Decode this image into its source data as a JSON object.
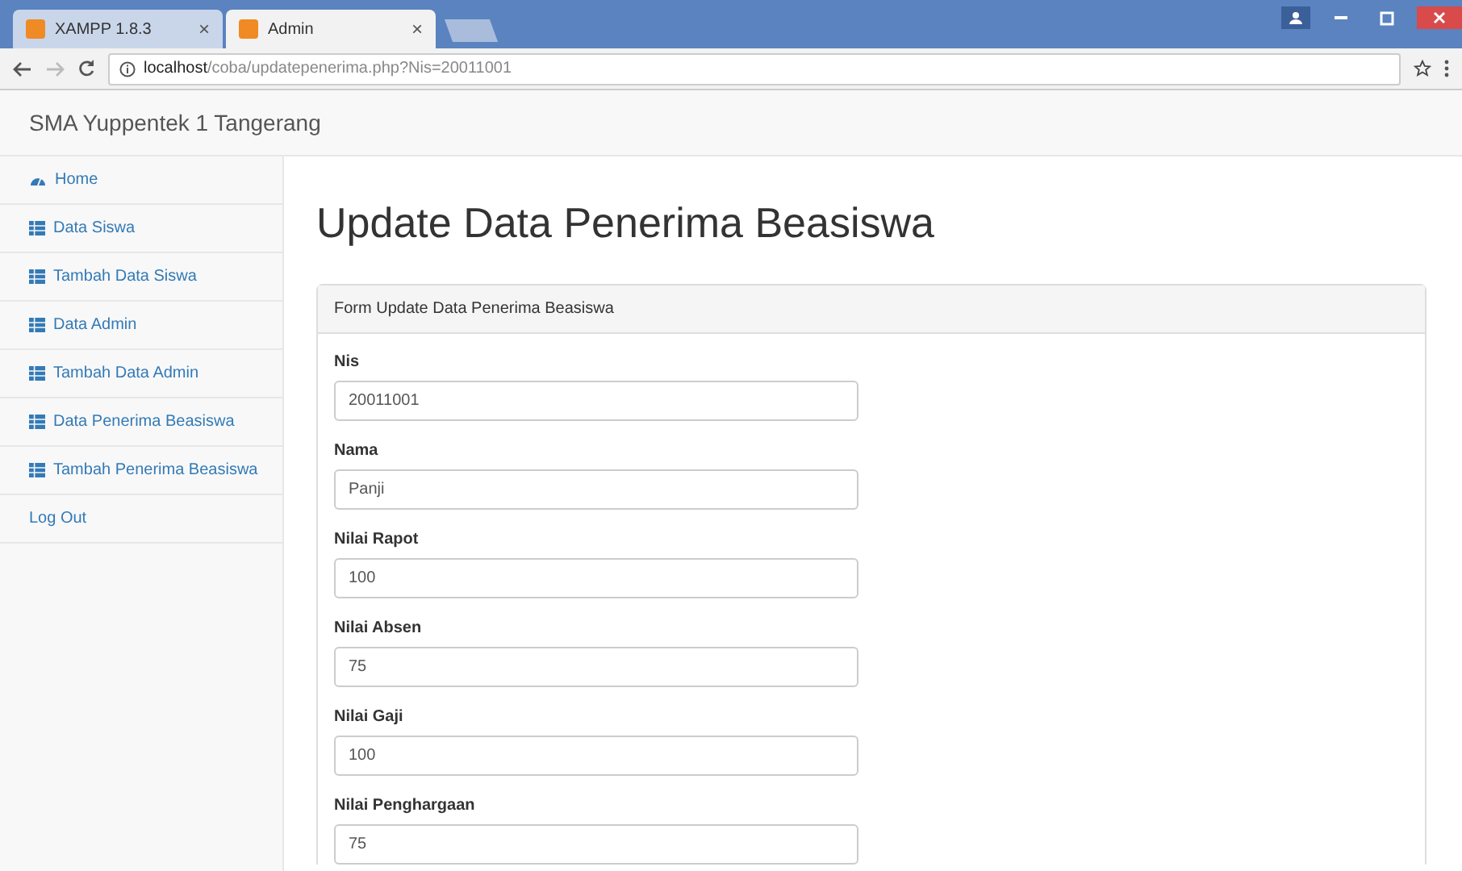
{
  "browser": {
    "tabs": [
      {
        "title": "XAMPP 1.8.3",
        "selected": false
      },
      {
        "title": "Admin",
        "selected": true
      }
    ],
    "close_glyph": "×",
    "url_host": "localhost",
    "url_path": "/coba/updatepenerima.php?Nis=20011001"
  },
  "navbar": {
    "brand": "SMA Yuppentek 1 Tangerang"
  },
  "sidebar": {
    "items": [
      {
        "label": "Home",
        "kind": "home"
      },
      {
        "label": "Data Siswa",
        "kind": "table"
      },
      {
        "label": "Tambah Data Siswa",
        "kind": "table"
      },
      {
        "label": "Data Admin",
        "kind": "table"
      },
      {
        "label": "Tambah Data Admin",
        "kind": "table"
      },
      {
        "label": "Data Penerima Beasiswa",
        "kind": "table"
      },
      {
        "label": "Tambah Penerima Beasiswa",
        "kind": "table"
      },
      {
        "label": "Log Out",
        "kind": "plain"
      }
    ]
  },
  "page": {
    "title": "Update Data Penerima Beasiswa",
    "panel_heading": "Form Update Data Penerima Beasiswa",
    "fields": [
      {
        "label": "Nis",
        "value": "20011001"
      },
      {
        "label": "Nama",
        "value": "Panji"
      },
      {
        "label": "Nilai Rapot",
        "value": "100"
      },
      {
        "label": "Nilai Absen",
        "value": "75"
      },
      {
        "label": "Nilai Gaji",
        "value": "100"
      },
      {
        "label": "Nilai Penghargaan",
        "value": "75"
      }
    ]
  }
}
